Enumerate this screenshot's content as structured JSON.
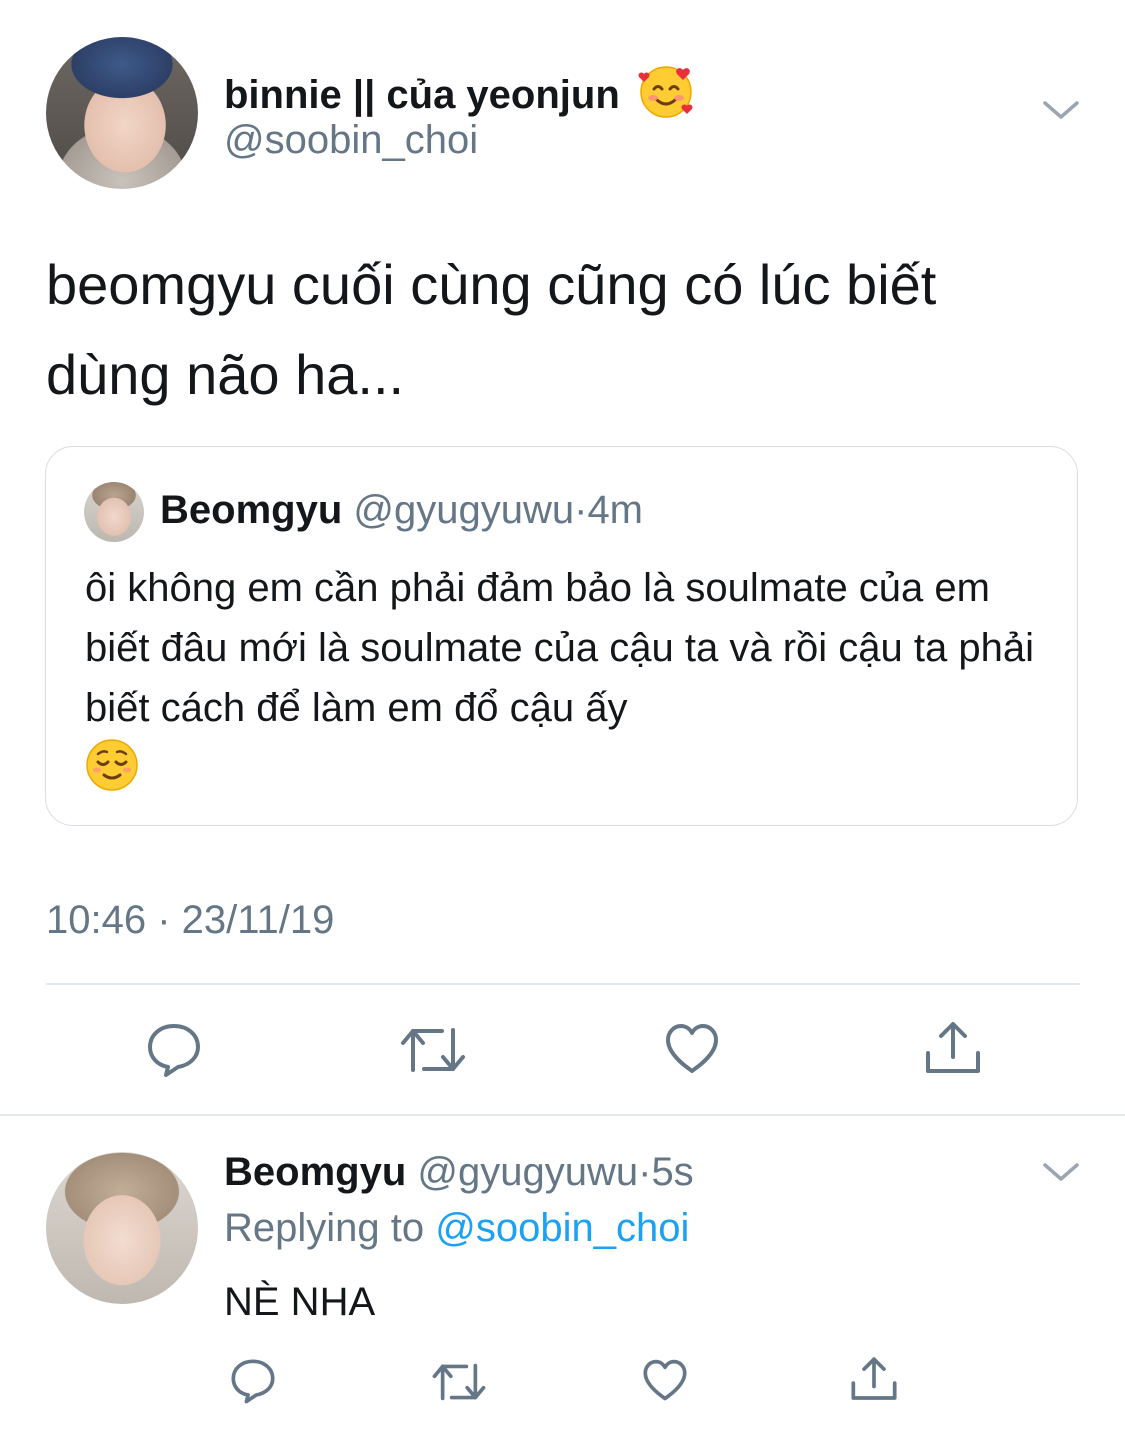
{
  "main_tweet": {
    "display_name": "binnie || của yeonjun",
    "name_emoji": "smiling-face-with-hearts",
    "handle": "@soobin_choi",
    "text": "beomgyu cuối cùng cũng có lúc biết dùng não ha...",
    "timestamp": "10:46 · 23/11/19"
  },
  "quoted_tweet": {
    "display_name": "Beomgyu",
    "handle": "@gyugyuwu",
    "separator": "·",
    "time": "4m",
    "text": "ôi không em cần phải đảm bảo là soulmate của em biết đâu mới là soulmate của cậu ta và rồi cậu ta phải biết cách để làm em đổ cậu ấy",
    "trailing_emoji": "relieved-face"
  },
  "actions": [
    "reply-icon",
    "retweet-icon",
    "like-icon",
    "share-icon"
  ],
  "reply": {
    "display_name": "Beomgyu",
    "handle": "@gyugyuwu",
    "separator": "·",
    "time": "5s",
    "replying_prefix": "Replying to",
    "replying_target": "@soobin_choi",
    "text": "NÈ NHA"
  },
  "colors": {
    "text": "#14171a",
    "secondary": "#657786",
    "link": "#1da1f2",
    "border": "#e1e8ed"
  }
}
